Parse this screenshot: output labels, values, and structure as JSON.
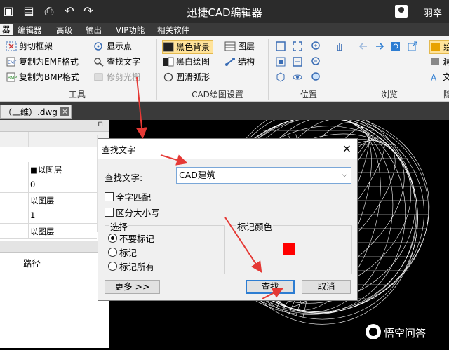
{
  "titlebar": {
    "title": "迅捷CAD编辑器",
    "user": "羽卒",
    "quick_icons": [
      "save-icon",
      "save-as-icon",
      "print-icon",
      "undo-icon",
      "redo-icon"
    ]
  },
  "menu": {
    "tabs": [
      "器",
      "编辑器",
      "高级",
      "输出",
      "VIP功能",
      "相关软件"
    ]
  },
  "ribbon": {
    "tools": {
      "label": "工具",
      "items": [
        "剪切框架",
        "复制为EMF格式",
        "复制为BMP格式",
        "显示点",
        "查找文字",
        "修剪光栅"
      ]
    },
    "cad": {
      "label": "CAD绘图设置",
      "items": [
        "黑色背景",
        "黑白绘图",
        "圆滑弧形",
        "图层",
        "结构"
      ]
    },
    "position": {
      "label": "位置"
    },
    "browse": {
      "label": "浏览"
    },
    "hidden": {
      "label": "隐",
      "items": [
        "绘",
        "洞",
        "文"
      ]
    }
  },
  "document": {
    "tab": "（三维）.dwg",
    "close": "×"
  },
  "properties": {
    "rows": [
      "■以图层",
      "0",
      "以图层",
      "1",
      "以图层"
    ],
    "pin": "⊓",
    "path_label": "路径"
  },
  "dialog": {
    "title": "查找文字",
    "close": "×",
    "find_label": "查找文字:",
    "find_value": "CAD建筑",
    "checkbox_whole": "全字匹配",
    "checkbox_case": "区分大小写",
    "select_legend": "选择",
    "radio_none": "不要标记",
    "radio_mark": "标记",
    "radio_all": "标记所有",
    "mark_color_legend": "标记颜色",
    "mark_color": "#ff0000",
    "more_button": "更多 >>",
    "find_button": "查找",
    "cancel_button": "取消"
  },
  "watermark": {
    "text": "悟空问答"
  },
  "colors": {
    "titlebar": "#2b2b2b",
    "accent": "#2d7dd2",
    "highlight": "#ffe39a"
  }
}
